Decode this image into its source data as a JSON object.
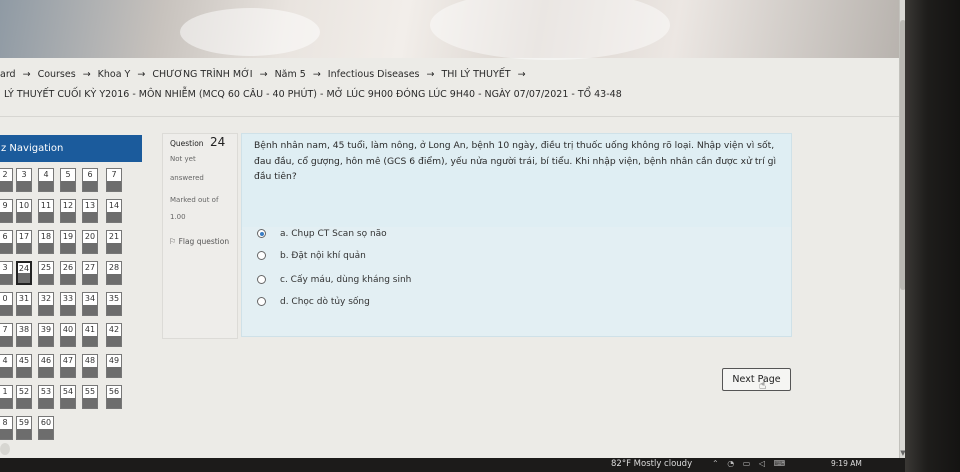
{
  "breadcrumb": {
    "items": [
      "ard",
      "Courses",
      "Khoa Y",
      "CHƯƠNG TRÌNH MỚI",
      "Năm 5",
      "Infectious Diseases",
      "THI LÝ THUYẾT",
      ""
    ],
    "separator": "→"
  },
  "page_title": "LÝ THUYẾT CUỐI KỲ Y2016 - MÔN NHIỄM (MCQ 60 CÂU - 40 PHÚT) - MỞ LÚC 9H00 ĐÓNG LÚC 9H40 - NGÀY 07/07/2021 - TỔ 43-48",
  "navigation": {
    "title": "z Navigation",
    "rows": [
      [
        "2",
        "3",
        "4",
        "5",
        "6",
        "7"
      ],
      [
        "9",
        "10",
        "11",
        "12",
        "13",
        "14"
      ],
      [
        "6",
        "17",
        "18",
        "19",
        "20",
        "21"
      ],
      [
        "3",
        "24",
        "25",
        "26",
        "27",
        "28"
      ],
      [
        "0",
        "31",
        "32",
        "33",
        "34",
        "35"
      ],
      [
        "7",
        "38",
        "39",
        "40",
        "41",
        "42"
      ],
      [
        "4",
        "45",
        "46",
        "47",
        "48",
        "49"
      ],
      [
        "1",
        "52",
        "53",
        "54",
        "55",
        "56"
      ],
      [
        "8",
        "59",
        "60"
      ]
    ],
    "current": "24"
  },
  "question_info": {
    "label": "Question",
    "number": "24",
    "status_line1": "Not yet",
    "status_line2": "answered",
    "marked_line": "Marked out of",
    "marked_value": "1.00",
    "flag_label": "Flag question",
    "flag_icon": "flag-icon"
  },
  "question": {
    "text": "Bệnh nhân nam, 45 tuổi, làm nông, ở Long An, bệnh 10 ngày, điều trị thuốc uống không rõ loại. Nhập viện vì sốt, đau đầu, cổ gượng, hôn mê (GCS 6 điểm), yếu nửa người trái, bí tiểu. Khi nhập viện, bệnh nhân cần được xử trí gì đầu tiên?",
    "options": [
      {
        "label": "a. Chụp CT Scan sọ não",
        "selected": true
      },
      {
        "label": "b. Đặt nội khí quản",
        "selected": false
      },
      {
        "label": "c. Cấy máu, dùng kháng sinh",
        "selected": false
      },
      {
        "label": "d. Chọc dò tủy sống",
        "selected": false
      }
    ]
  },
  "next_button": "Next Page",
  "taskbar": {
    "weather": "82°F  Mostly cloudy",
    "time": "9:19 AM",
    "tray_icons": "⌃ ◔ ▭ ◁ ⌨"
  },
  "colors": {
    "nav_header": "#1b5b9c",
    "content_bg": "#dfeef3",
    "info_bg": "#eeedea"
  }
}
